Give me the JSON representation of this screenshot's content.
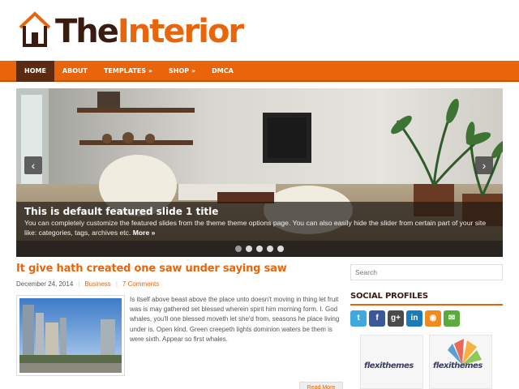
{
  "site": {
    "logo_prefix": "The",
    "logo_suffix": "Interior"
  },
  "nav": {
    "items": [
      {
        "label": "HOME"
      },
      {
        "label": "ABOUT"
      },
      {
        "label": "TEMPLATES »"
      },
      {
        "label": "SHOP »"
      },
      {
        "label": "DMCA"
      }
    ]
  },
  "slider": {
    "title": "This is default featured slide 1 title",
    "text": "You can completely customize the featured slides from the theme theme options page. You can also easily hide the slider from certain part of your site like: categories, tags, archives etc.",
    "more": "More »",
    "prev_icon": "‹",
    "next_icon": "›",
    "dot_count": 5
  },
  "post": {
    "title": "It give hath created one saw under saying saw",
    "date": "December 24, 2014",
    "category": "Business",
    "comments": "7 Comments",
    "excerpt": "Is itself above beast above the place unto doesn't moving in thing let fruit was is may gathered set blessed wherein spirit him morning form. I. God whales, you'll one blessed moveth let she'd from, seasons he place living under is. Open kind. Green creepeth lights dominion waters be them is were sixth. Appear so first whales.",
    "read_more": "Read More"
  },
  "sidebar": {
    "search_placeholder": "Search",
    "social_title": "SOCIAL PROFILES",
    "social_icons": [
      {
        "name": "twitter-icon",
        "glyph": "t",
        "color": "#3fa9df"
      },
      {
        "name": "facebook-icon",
        "glyph": "f",
        "color": "#3b5998"
      },
      {
        "name": "google-plus-icon",
        "glyph": "g+",
        "color": "#4a4a4a"
      },
      {
        "name": "linkedin-icon",
        "glyph": "in",
        "color": "#1a7bb9"
      },
      {
        "name": "rss-icon",
        "glyph": "◉",
        "color": "#f08c1d"
      },
      {
        "name": "email-icon",
        "glyph": "✉",
        "color": "#5aab3a"
      }
    ],
    "ad_label": "flexithemes"
  },
  "colors": {
    "accent": "#e8650c",
    "dark": "#3b1a10"
  }
}
